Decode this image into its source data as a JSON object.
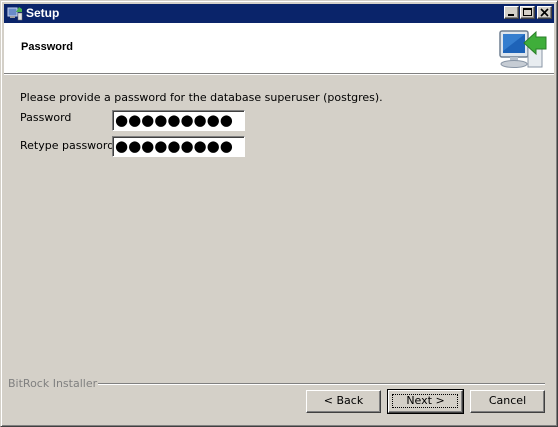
{
  "window": {
    "title": "Setup",
    "controls": [
      "minimize-icon",
      "maximize-icon",
      "close-icon"
    ]
  },
  "header": {
    "title": "Password",
    "icon": "installer-monitor-arrow-icon"
  },
  "form": {
    "intro": "Please provide a password for the database superuser (postgres).",
    "password_label": "Password",
    "password_value": "●●●●●●●●●",
    "retype_label": "Retype password",
    "retype_value": "●●●●●●●●●"
  },
  "footer": {
    "brand": "BitRock Installer",
    "back_label": "< Back",
    "next_label": "Next >",
    "cancel_label": "Cancel"
  },
  "colors": {
    "titlebar": "#0a246a",
    "window_bg": "#d4d0c8",
    "header_bg": "#ffffff"
  }
}
